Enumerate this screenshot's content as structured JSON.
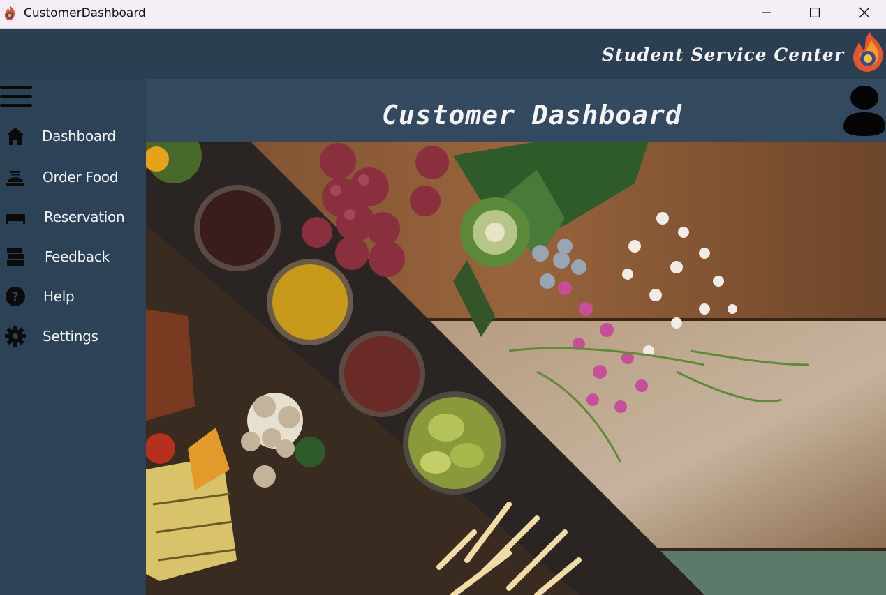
{
  "window": {
    "title": "CustomerDashboard",
    "controls": [
      "minimize-icon",
      "maximize-icon",
      "close-icon"
    ]
  },
  "header": {
    "brand": "Student Service Center",
    "logo": "flame-logo"
  },
  "sidebar": {
    "menu_icon": "hamburger-icon",
    "items": [
      {
        "label": "Dashboard",
        "icon": "home-icon"
      },
      {
        "label": "Order Food",
        "icon": "food-tray-icon"
      },
      {
        "label": "Reservation",
        "icon": "bed-icon"
      },
      {
        "label": "Feedback",
        "icon": "stack-icon"
      },
      {
        "label": "Help",
        "icon": "question-icon"
      },
      {
        "label": "Settings",
        "icon": "gear-icon"
      }
    ]
  },
  "main": {
    "title": "Customer Dashboard",
    "avatar": "user-avatar-icon",
    "hero": "food-table-photo"
  },
  "colors": {
    "header_bg": "#2c3e51",
    "sidebar_bg": "#2e4257",
    "title_band_bg": "#33495f",
    "text": "#f0f3f6"
  }
}
